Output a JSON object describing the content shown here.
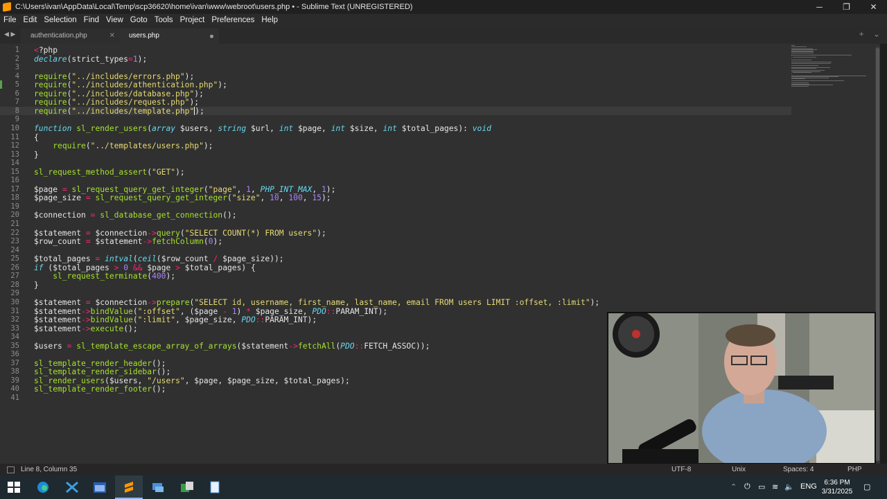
{
  "window": {
    "title": "C:\\Users\\ivan\\AppData\\Local\\Temp\\scp36620\\home\\ivan\\www\\webroot\\users.php • - Sublime Text (UNREGISTERED)",
    "minimize_glyph": "─",
    "maximize_glyph": "❐",
    "close_glyph": "✕"
  },
  "menu": [
    "File",
    "Edit",
    "Selection",
    "Find",
    "View",
    "Goto",
    "Tools",
    "Project",
    "Preferences",
    "Help"
  ],
  "tabs": [
    {
      "label": "authentication.php",
      "active": false
    },
    {
      "label": "users.php",
      "active": true,
      "dirty": true
    }
  ],
  "tab_nav": {
    "left": "◀",
    "right": "▶",
    "close": "✕"
  },
  "tab_actions": {
    "plus": "+",
    "menu": "⌄"
  },
  "status": {
    "position": "Line 8, Column 35",
    "encoding": "UTF-8",
    "line_endings": "Unix",
    "indentation": "Spaces: 4",
    "syntax": "PHP"
  },
  "clock": {
    "time": "6:36 PM",
    "date": "3/31/2025"
  },
  "tray": {
    "lang": "ENG"
  },
  "colors": {
    "accent": "#f92672",
    "string": "#e6db74",
    "number": "#ae81ff",
    "function": "#a6e22e",
    "type": "#66d9ef"
  },
  "code": [
    "<?php",
    "declare(strict_types=1);",
    "",
    "require(\"../includes/errors.php\");",
    "require(\"../includes/athentication.php\");",
    "require(\"../includes/database.php\");",
    "require(\"../includes/request.php\");",
    "require(\"../includes/template.php\");",
    "",
    "function sl_render_users(array $users, string $url, int $page, int $size, int $total_pages): void",
    "{",
    "    require(\"../templates/users.php\");",
    "}",
    "",
    "sl_request_method_assert(\"GET\");",
    "",
    "$page = sl_request_query_get_integer(\"page\", 1, PHP_INT_MAX, 1);",
    "$page_size = sl_request_query_get_integer(\"size\", 10, 100, 15);",
    "",
    "$connection = sl_database_get_connection();",
    "",
    "$statement = $connection->query(\"SELECT COUNT(*) FROM users\");",
    "$row_count = $statement->fetchColumn(0);",
    "",
    "$total_pages = intval(ceil($row_count / $page_size));",
    "if ($total_pages > 0 && $page > $total_pages) {",
    "    sl_request_terminate(400);",
    "}",
    "",
    "$statement = $connection->prepare(\"SELECT id, username, first_name, last_name, email FROM users LIMIT :offset, :limit\");",
    "$statement->bindValue(\":offset\", ($page - 1) * $page_size, PDO::PARAM_INT);",
    "$statement->bindValue(\":limit\", $page_size, PDO::PARAM_INT);",
    "$statement->execute();",
    "",
    "$users = sl_template_escape_array_of_arrays($statement->fetchAll(PDO::FETCH_ASSOC));",
    "",
    "sl_template_render_header();",
    "sl_template_render_sidebar();",
    "sl_render_users($users, \"/users\", $page, $page_size, $total_pages);",
    "sl_template_render_footer();",
    ""
  ],
  "line_numbers": [
    "1",
    "2",
    "3",
    "4",
    "5",
    "6",
    "7",
    "8",
    "9",
    "10",
    "11",
    "12",
    "13",
    "14",
    "15",
    "16",
    "17",
    "18",
    "19",
    "20",
    "21",
    "22",
    "23",
    "24",
    "25",
    "26",
    "27",
    "28",
    "29",
    "30",
    "31",
    "32",
    "33",
    "34",
    "35",
    "36",
    "37",
    "38",
    "39",
    "40",
    "41"
  ],
  "current_line": 8,
  "modified_line": 5
}
